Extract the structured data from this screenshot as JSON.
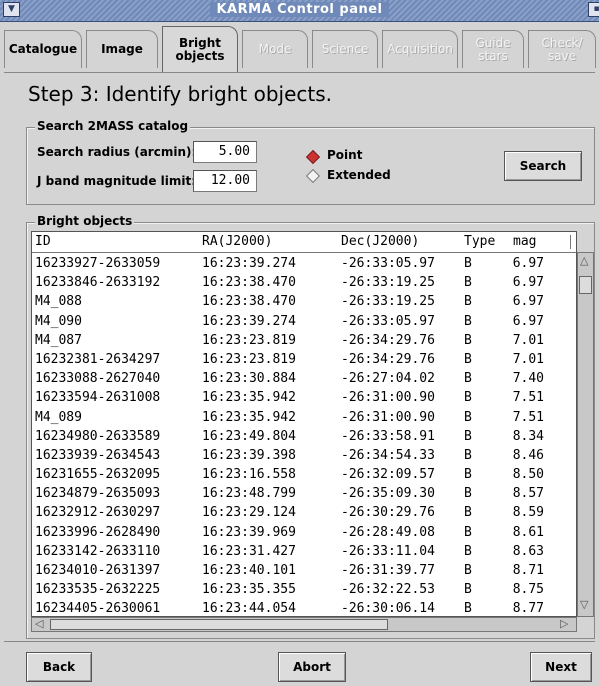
{
  "window": {
    "title": "KARMA Control panel"
  },
  "tabs": [
    {
      "label": "Catalogue",
      "state": "normal"
    },
    {
      "label": "Image",
      "state": "normal"
    },
    {
      "label": "Bright objects",
      "state": "active"
    },
    {
      "label": "Mode",
      "state": "disabled"
    },
    {
      "label": "Science",
      "state": "disabled"
    },
    {
      "label": "Acquisition",
      "state": "disabled"
    },
    {
      "label": "Guide stars",
      "state": "disabled"
    },
    {
      "label": "Check/ save",
      "state": "disabled"
    }
  ],
  "step_title": "Step 3: Identify bright objects.",
  "search": {
    "group_label": "Search 2MASS catalog",
    "radius_label": "Search radius (arcmin):",
    "radius_value": "5.00",
    "mag_label": "J band magnitude limit:",
    "mag_value": "12.00",
    "radio_point": "Point",
    "radio_extended": "Extended",
    "selected": "Point",
    "search_button": "Search"
  },
  "bright": {
    "group_label": "Bright objects",
    "columns": [
      "ID",
      "RA(J2000)",
      "Dec(J2000)",
      "Type",
      "mag"
    ],
    "rows": [
      [
        "16233927-2633059",
        "16:23:39.274",
        "-26:33:05.97",
        "B",
        "6.97"
      ],
      [
        "16233846-2633192",
        "16:23:38.470",
        "-26:33:19.25",
        "B",
        "6.97"
      ],
      [
        "M4_088",
        "16:23:38.470",
        "-26:33:19.25",
        "B",
        "6.97"
      ],
      [
        "M4_090",
        "16:23:39.274",
        "-26:33:05.97",
        "B",
        "6.97"
      ],
      [
        "M4_087",
        "16:23:23.819",
        "-26:34:29.76",
        "B",
        "7.01"
      ],
      [
        "16232381-2634297",
        "16:23:23.819",
        "-26:34:29.76",
        "B",
        "7.01"
      ],
      [
        "16233088-2627040",
        "16:23:30.884",
        "-26:27:04.02",
        "B",
        "7.40"
      ],
      [
        "16233594-2631008",
        "16:23:35.942",
        "-26:31:00.90",
        "B",
        "7.51"
      ],
      [
        "M4_089",
        "16:23:35.942",
        "-26:31:00.90",
        "B",
        "7.51"
      ],
      [
        "16234980-2633589",
        "16:23:49.804",
        "-26:33:58.91",
        "B",
        "8.34"
      ],
      [
        "16233939-2634543",
        "16:23:39.398",
        "-26:34:54.33",
        "B",
        "8.46"
      ],
      [
        "16231655-2632095",
        "16:23:16.558",
        "-26:32:09.57",
        "B",
        "8.50"
      ],
      [
        "16234879-2635093",
        "16:23:48.799",
        "-26:35:09.30",
        "B",
        "8.57"
      ],
      [
        "16232912-2630297",
        "16:23:29.124",
        "-26:30:29.76",
        "B",
        "8.59"
      ],
      [
        "16233996-2628490",
        "16:23:39.969",
        "-26:28:49.08",
        "B",
        "8.61"
      ],
      [
        "16233142-2633110",
        "16:23:31.427",
        "-26:33:11.04",
        "B",
        "8.63"
      ],
      [
        "16234010-2631397",
        "16:23:40.101",
        "-26:31:39.77",
        "B",
        "8.71"
      ],
      [
        "16233535-2632225",
        "16:23:35.355",
        "-26:32:22.53",
        "B",
        "8.75"
      ],
      [
        "16234405-2630061",
        "16:23:44.054",
        "-26:30:06.14",
        "B",
        "8.77"
      ]
    ]
  },
  "footer": {
    "back": "Back",
    "abort": "Abort",
    "next": "Next"
  }
}
